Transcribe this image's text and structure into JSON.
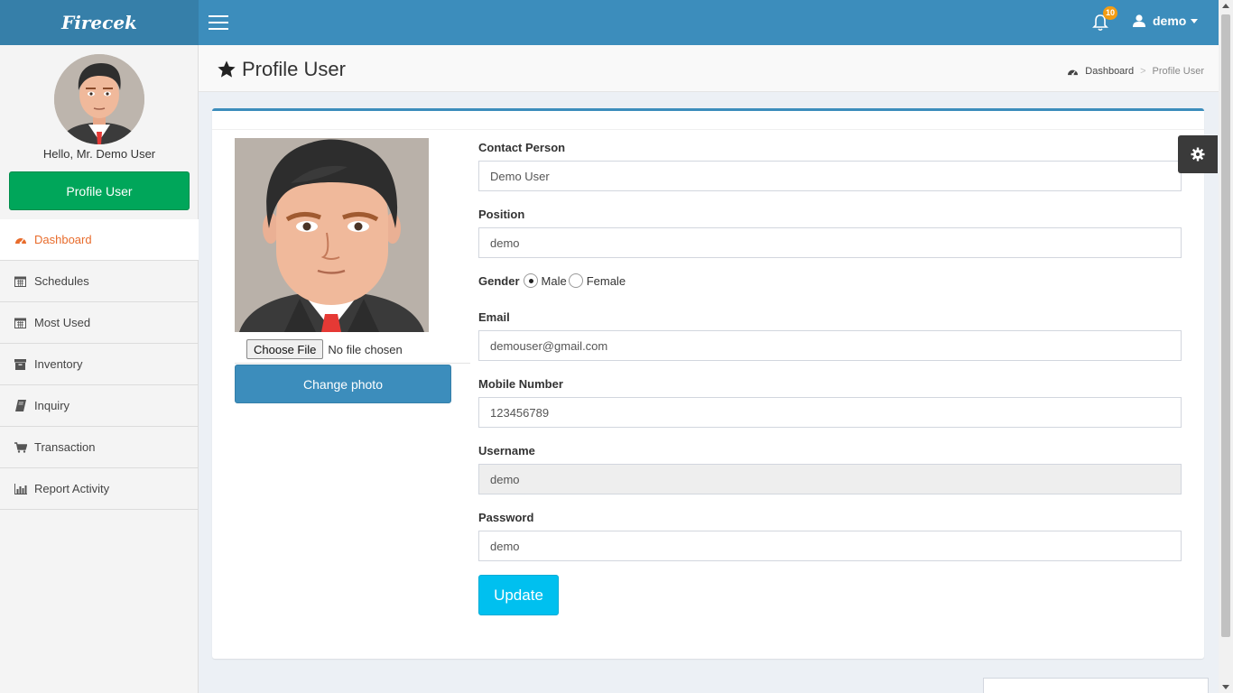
{
  "header": {
    "brand": "Firecek",
    "notification_count": "10",
    "user_name": "demo"
  },
  "sidebar": {
    "greeting": "Hello, Mr. Demo User",
    "profile_button": "Profile User",
    "items": [
      {
        "label": "Dashboard",
        "icon": "dashboard-icon",
        "active": true
      },
      {
        "label": "Schedules",
        "icon": "calendar-icon"
      },
      {
        "label": "Most Used",
        "icon": "calendar-icon"
      },
      {
        "label": "Inventory",
        "icon": "archive-icon"
      },
      {
        "label": "Inquiry",
        "icon": "book-icon"
      },
      {
        "label": "Transaction",
        "icon": "cart-icon"
      },
      {
        "label": "Report Activity",
        "icon": "bar-chart-icon"
      }
    ]
  },
  "page": {
    "title": "Profile User",
    "breadcrumb": {
      "home": "Dashboard",
      "current": "Profile User"
    }
  },
  "photo": {
    "choose_file": "Choose File",
    "no_file": "No file chosen",
    "change_button": "Change photo"
  },
  "form": {
    "contact_person": {
      "label": "Contact Person",
      "value": "Demo User"
    },
    "position": {
      "label": "Position",
      "value": "demo"
    },
    "gender": {
      "label": "Gender",
      "options": [
        "Male",
        "Female"
      ],
      "selected": "Male"
    },
    "email": {
      "label": "Email",
      "value": "demouser@gmail.com"
    },
    "mobile": {
      "label": "Mobile Number",
      "value": "123456789"
    },
    "username": {
      "label": "Username",
      "value": "demo"
    },
    "password": {
      "label": "Password",
      "value": "demo"
    },
    "update_button": "Update"
  },
  "colors": {
    "header": "#3c8dbc",
    "brand_bg": "#367fa9",
    "profile_button": "#00a65a",
    "active_menu": "#e86c2c",
    "update_button": "#00c0ef",
    "badge": "#f39c12"
  }
}
